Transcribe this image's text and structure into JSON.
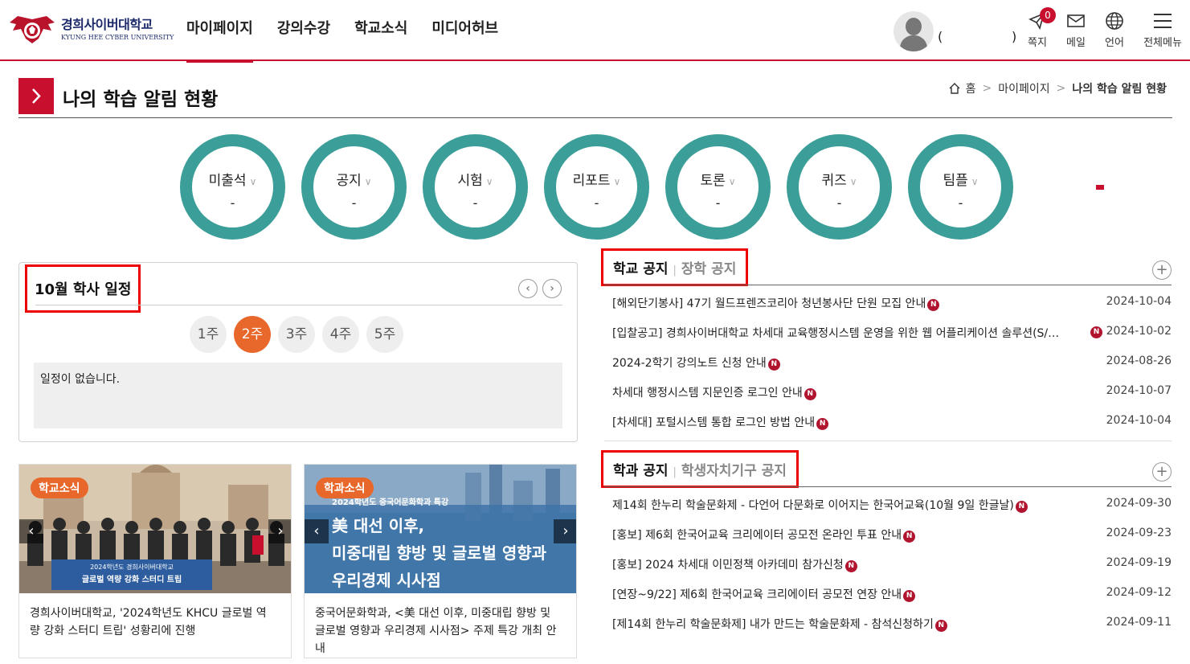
{
  "header": {
    "logo_kr": "경희사이버대학교",
    "logo_en": "KYUNG HEE CYBER UNIVERSITY",
    "nav": [
      "마이페이지",
      "강의수강",
      "학교소식",
      "미디어허브"
    ],
    "user_open": "(",
    "user_close": ")",
    "utils": [
      {
        "label": "쪽지",
        "icon": "message-icon",
        "badge": "0"
      },
      {
        "label": "메일",
        "icon": "mail-icon"
      },
      {
        "label": "언어",
        "icon": "globe-icon"
      },
      {
        "label": "전체메뉴",
        "icon": "hamburger-menu-icon"
      }
    ],
    "accent": "#c8102e"
  },
  "page": {
    "title": "나의 학습 알림 현황",
    "breadcrumb": [
      "홈",
      "마이페이지",
      "나의 학습 알림 현황"
    ]
  },
  "stats": [
    {
      "label": "미출석",
      "value": "-"
    },
    {
      "label": "공지",
      "value": "-"
    },
    {
      "label": "시험",
      "value": "-"
    },
    {
      "label": "리포트",
      "value": "-"
    },
    {
      "label": "토론",
      "value": "-"
    },
    {
      "label": "퀴즈",
      "value": "-"
    },
    {
      "label": "팀플",
      "value": "-"
    }
  ],
  "schedule": {
    "title": "10월 학사 일정",
    "weeks": [
      "1주",
      "2주",
      "3주",
      "4주",
      "5주"
    ],
    "active_week": "2주",
    "empty": "일정이 없습니다."
  },
  "cards": [
    {
      "tag": "학교소식",
      "caption": "경희사이버대학교, '2024학년도 KHCU 글로벌 역량 강화 스터디 트립' 성황리에 진행",
      "banner_top": "2024학년도 경희사이버대학교",
      "banner_main": "글로벌 역량 강화 스터디 트립"
    },
    {
      "tag": "학과소식",
      "caption": "중국어문화학과, <美 대선 이후, 미중대립 향방 및 글로벌 영향과 우리경제 시사점> 주제 특강 개최 안내",
      "img_sub": "2024학년도 중국어문화학과 특강",
      "img_line1": "美 대선 이후,",
      "img_line2": "미중대립 향방 및 글로벌 영향과",
      "img_line3": "우리경제 시사점"
    }
  ],
  "school_notice": {
    "tab1": "학교 공지",
    "tab2": "장학 공지",
    "items": [
      {
        "text": "[해외단기봉사] 47기 월드프렌즈코리아 청년봉사단 단원 모집 안내",
        "date": "2024-10-04"
      },
      {
        "text": "[입찰공고] 경희사이버대학교 차세대 교육행정시스템 운영을 위한 웹 어플리케이션 솔루션(S/…",
        "date": "2024-10-02"
      },
      {
        "text": "2024-2학기 강의노트 신청 안내",
        "date": "2024-08-26"
      },
      {
        "text": "차세대 행정시스템 지문인증 로그인 안내",
        "date": "2024-10-07"
      },
      {
        "text": "[차세대] 포털시스템 통합 로그인 방법 안내",
        "date": "2024-10-04"
      }
    ]
  },
  "dept_notice": {
    "tab1": "학과 공지",
    "tab2": "학생자치기구 공지",
    "items": [
      {
        "text": "제14회 한누리 학술문화제 - 다언어 다문화로 이어지는 한국어교육(10월 9일 한글날)",
        "date": "2024-09-30"
      },
      {
        "text": "[홍보] 제6회 한국어교육 크리에이터 공모전 온라인 투표 안내",
        "date": "2024-09-23"
      },
      {
        "text": "[홍보] 2024 차세대 이민정책 아카데미 참가신청",
        "date": "2024-09-19"
      },
      {
        "text": "[연장~9/22] 제6회 한국어교육 크리에이터 공모전 연장 안내",
        "date": "2024-09-12"
      },
      {
        "text": "[제14회 한누리 학술문화제] 내가 만드는 학술문화제 - 참석신청하기",
        "date": "2024-09-11"
      }
    ],
    "new_badge": "N"
  },
  "colors": {
    "ring": "#3c9e98",
    "tag": "#e8672a",
    "highlight": "#e00000"
  }
}
